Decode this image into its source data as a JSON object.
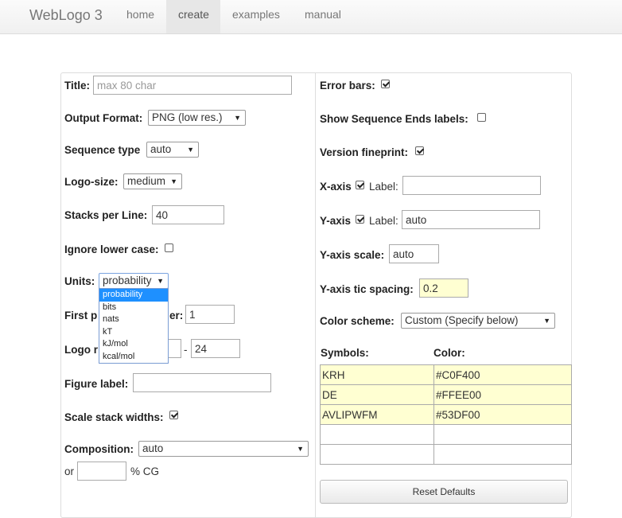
{
  "nav": {
    "brand": "WebLogo 3",
    "items": [
      "home",
      "create",
      "examples",
      "manual"
    ],
    "active": "create"
  },
  "left": {
    "title": {
      "label": "Title:",
      "placeholder": "max 80 char"
    },
    "output_format": {
      "label": "Output Format:",
      "value": "PNG (low res.)"
    },
    "sequence_type": {
      "label": "Sequence type",
      "value": "auto"
    },
    "logo_size": {
      "label": "Logo-size:",
      "value": "medium"
    },
    "stacks_per_line": {
      "label": "Stacks per Line:",
      "value": "40"
    },
    "ignore_lower_case": {
      "label": "Ignore lower case:",
      "checked": false
    },
    "units": {
      "label": "Units:",
      "value": "probability",
      "options": [
        "probability",
        "bits",
        "nats",
        "kT",
        "kJ/mol",
        "kcal/mol"
      ]
    },
    "first_position": {
      "label_start": "First p",
      "label_end": "er:",
      "value": "1"
    },
    "logo_range": {
      "label_start": "Logo r",
      "separator": "-",
      "end_value": "24"
    },
    "figure_label": {
      "label": "Figure label:",
      "value": ""
    },
    "scale_stack_widths": {
      "label": "Scale stack widths:",
      "checked": true
    },
    "composition": {
      "label": "Composition:",
      "value": "auto",
      "or_label": "or",
      "cg_label": "% CG",
      "cg_value": ""
    }
  },
  "right": {
    "error_bars": {
      "label": "Error bars:",
      "checked": true
    },
    "show_sequence_ends": {
      "label": "Show Sequence Ends labels:",
      "checked": false
    },
    "version_fineprint": {
      "label": "Version fineprint:",
      "checked": true
    },
    "x_axis": {
      "label": "X-axis",
      "checked": true,
      "label_text": "Label:",
      "value": ""
    },
    "y_axis": {
      "label": "Y-axis",
      "checked": true,
      "label_text": "Label:",
      "value": "auto"
    },
    "y_axis_scale": {
      "label": "Y-axis scale:",
      "value": "auto"
    },
    "y_axis_tic_spacing": {
      "label": "Y-axis tic spacing:",
      "value": "0.2"
    },
    "color_scheme": {
      "label": "Color scheme:",
      "value": "Custom (Specify below)"
    },
    "symbols_header": "Symbols:",
    "color_header": "Color:",
    "rows": [
      {
        "symbols": "KRH",
        "color": "#C0F400"
      },
      {
        "symbols": "DE",
        "color": "#FFEE00"
      },
      {
        "symbols": "AVLIPWFM",
        "color": "#53DF00"
      },
      {
        "symbols": "",
        "color": ""
      },
      {
        "symbols": "",
        "color": ""
      }
    ],
    "reset_button": "Reset Defaults"
  }
}
